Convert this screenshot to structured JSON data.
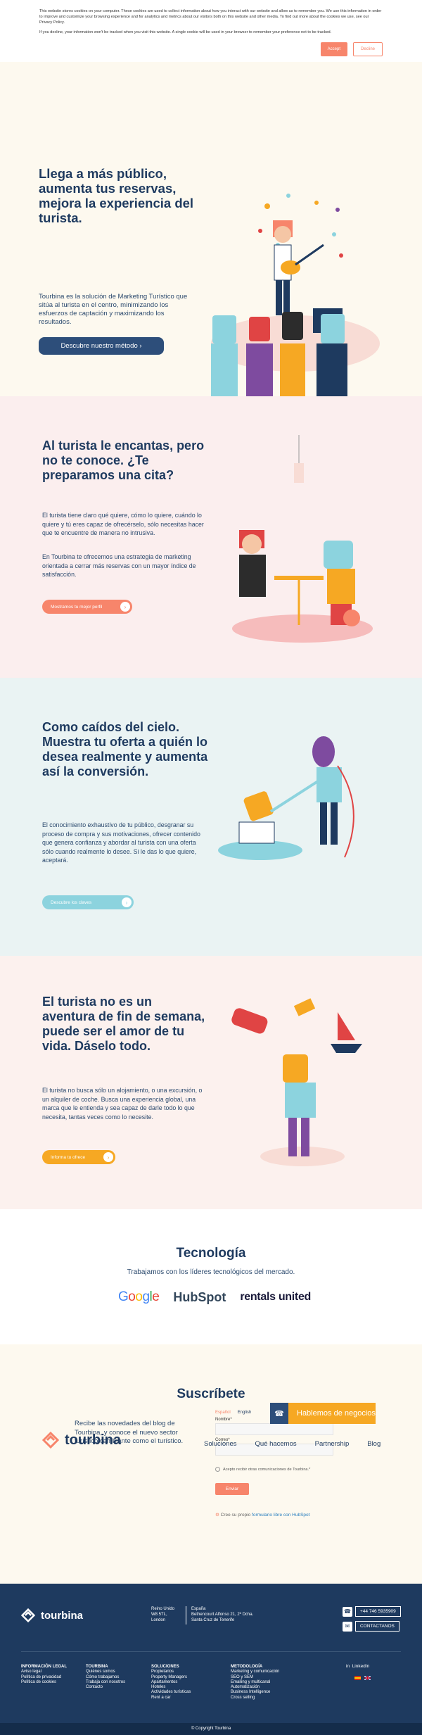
{
  "cookie": {
    "text1": "This website stores cookies on your computer. These cookies are used to collect information about how you interact with our website and allow us to remember you. We use this information in order to improve and customize your browsing experience and for analytics and metrics about our visitors both on this website and other media. To find out more about the cookies we use, see our Privacy Policy.",
    "text2": "If you decline, your information won't be tracked when you visit this website. A single cookie will be used in your browser to remember your preference not to be tracked.",
    "accept": "Accept",
    "decline": "Decline"
  },
  "hero": {
    "title": "Llega a más público, aumenta tus reservas, mejora la experiencia del turista.",
    "desc": "Tourbina es la solución de Marketing Turístico que sitúa al turista en el centro, minimizando los esfuerzos de captación y maximizando los resultados.",
    "button": "Descubre nuestro método"
  },
  "s2": {
    "title": "Al turista le encantas, pero no te conoce. ¿Te preparamos una cita?",
    "desc1": "El turista tiene claro qué quiere, cómo lo quiere, cuándo lo quiere y tú eres capaz de ofrecérselo, sólo necesitas hacer que te encuentre de manera no intrusiva.",
    "desc2": "En Tourbina te ofrecemos una estrategia de marketing orientada a cerrar más reservas con un mayor índice de satisfacción.",
    "button": "Mostramos tu mejor perfil"
  },
  "s3": {
    "title": "Como caídos del cielo. Muestra tu oferta a quién lo desea realmente y aumenta así la conversión.",
    "desc": "El conocimiento exhaustivo de tu público, desgranar su proceso de compra y sus motivaciones, ofrecer contenido que genera confianza y abordar al turista con una oferta sólo cuando realmente lo desee. Si le das lo que quiere, aceptará.",
    "button": "Descubre los claves"
  },
  "s4": {
    "title": "El turista no es un aventura de fin de semana, puede ser el amor de tu vida. Dáselo todo.",
    "desc": "El turista no busca sólo un alojamiento, o una excursión, o un alquiler de coche. Busca una experiencia global, una marca que le entienda y sea capaz de darle todo lo que necesita, tantas veces como lo necesite.",
    "button": "Informa tu ofrece"
  },
  "tech": {
    "title": "Tecnología",
    "subtitle": "Trabajamos con los líderes tecnológicos del mercado.",
    "logos": [
      "Google",
      "HubSpot",
      "rentals united"
    ]
  },
  "subscribe": {
    "title": "Suscríbete",
    "text": "Recibe las novedades del blog de Tourbina, y conoce el nuevo sector turístico cambiante como el turístico.",
    "lang_es": "Español",
    "lang_en": "English",
    "name_label": "Nombre*",
    "email_label": "Correo*",
    "consent": "Acepto recibir otras comunicaciones de Tourbina.*",
    "submit": "Enviar",
    "hubspot": "Cree su propio",
    "hubspot_link": "formulario libre con HubSpot"
  },
  "overlay": {
    "brand": "tourbina",
    "nav": [
      "Soluciones",
      "Qué hacemos",
      "Partnership",
      "Blog"
    ],
    "cta": "Hablemos de negocios"
  },
  "footer": {
    "brand": "tourbina",
    "addr_uk": [
      "Reino Unido",
      "W8 5TL,",
      "London"
    ],
    "addr_es": [
      "España",
      "Bethencourt Alfonso 21, 2º Dcha.",
      "Santa Cruz de Tenerife"
    ],
    "phone": "+44 746 5935909",
    "contact": "CONTACTANOS",
    "cols": [
      {
        "h": "INFORMACIÓN LEGAL",
        "items": [
          "Aviso legal",
          "Política de privacidad",
          "Política de cookies"
        ]
      },
      {
        "h": "TOURBINA",
        "items": [
          "Quiénes somos",
          "Cómo trabajamos",
          "Trabaja con nosotros",
          "Contacto"
        ]
      },
      {
        "h": "SOLUCIONES",
        "items": [
          "Propietarios",
          "Property Managers",
          "Apartamentos",
          "Hoteles",
          "Actividades turísticas",
          "Rent a car"
        ]
      },
      {
        "h": "METODOLOGÍA",
        "items": [
          "Marketing y comunicación",
          "SEO y SEM",
          "Emailing y multicanal",
          "Automatización",
          "Business Intelligence",
          "Cross selling"
        ]
      }
    ],
    "social": "LinkedIn",
    "copyright": "© Copyright Tourbina"
  },
  "colors": {
    "navy": "#1e3a5f",
    "coral": "#f7856b",
    "teal": "#8cd3de",
    "orange": "#f6a823"
  }
}
